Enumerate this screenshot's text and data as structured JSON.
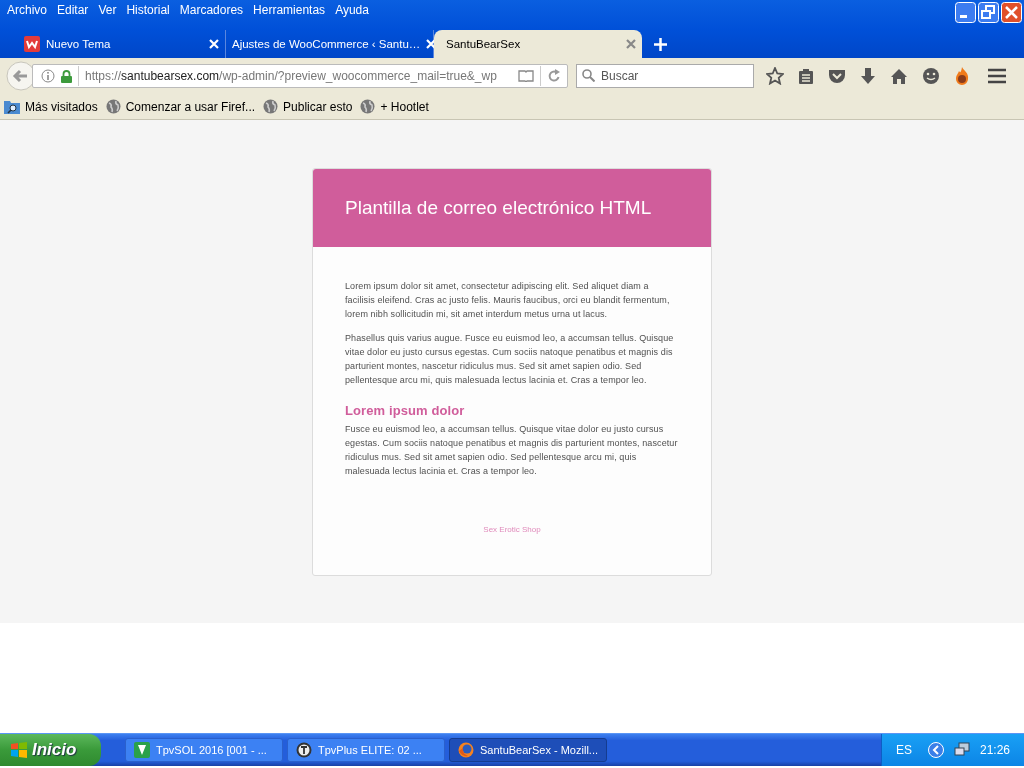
{
  "menu_bar": {
    "items": [
      "Archivo",
      "Editar",
      "Ver",
      "Historial",
      "Marcadores",
      "Herramientas",
      "Ayuda"
    ]
  },
  "tabs": [
    {
      "label": "Nuevo Tema",
      "selected": false,
      "kind": "logo"
    },
    {
      "label": "Ajustes de WooCommerce ‹ Santu…",
      "selected": false,
      "kind": "plain"
    },
    {
      "label": "SantuBearSex",
      "selected": true,
      "kind": "plain"
    }
  ],
  "address_bar": {
    "scheme": "https://",
    "host": "santubearsex.com",
    "path": "/wp-admin/?preview_woocommerce_mail=true&_wp"
  },
  "search": {
    "placeholder": "Buscar"
  },
  "bookmarks": [
    {
      "label": "Más visitados",
      "kind": "folder"
    },
    {
      "label": "Comenzar a usar Firef...",
      "kind": "globe"
    },
    {
      "label": "Publicar esto",
      "kind": "globe"
    },
    {
      "label": "+ Hootlet",
      "kind": "globe"
    }
  ],
  "email": {
    "title": "Plantilla de correo electrónico HTML",
    "paragraphs": [
      "Lorem ipsum dolor sit amet, consectetur adipiscing elit. Sed aliquet diam a facilisis eleifend. Cras ac justo felis. Mauris faucibus, orci eu blandit fermentum, lorem nibh sollicitudin mi, sit amet interdum metus urna ut lacus.",
      "Phasellus quis varius augue. Fusce eu euismod leo, a accumsan tellus. Quisque vitae dolor eu justo cursus egestas. Cum sociis natoque penatibus et magnis dis parturient montes, nascetur ridiculus mus. Sed sit amet sapien odio. Sed pellentesque arcu mi, quis malesuada lectus lacinia et. Cras a tempor leo."
    ],
    "heading": "Lorem ipsum dolor",
    "paragraphs_2": [
      "Fusce eu euismod leo, a accumsan tellus. Quisque vitae dolor eu justo cursus egestas. Cum sociis natoque penatibus et magnis dis parturient montes, nascetur ridiculus mus. Sed sit amet sapien odio. Sed pellentesque arcu mi, quis malesuada lectus lacinia et. Cras a tempor leo."
    ],
    "footer": "Sex Erotic Shop"
  },
  "taskbar": {
    "start": "Inicio",
    "tasks": [
      {
        "label": "TpvSOL 2016  [001 - ...",
        "selected": false,
        "kind": "tpvsol"
      },
      {
        "label": "TpvPlus ELITE: 02  ...",
        "selected": false,
        "kind": "tpvplus"
      },
      {
        "label": "SantuBearSex - Mozill...",
        "selected": true,
        "kind": "firefox"
      }
    ],
    "language": "ES",
    "clock": "21:26"
  }
}
